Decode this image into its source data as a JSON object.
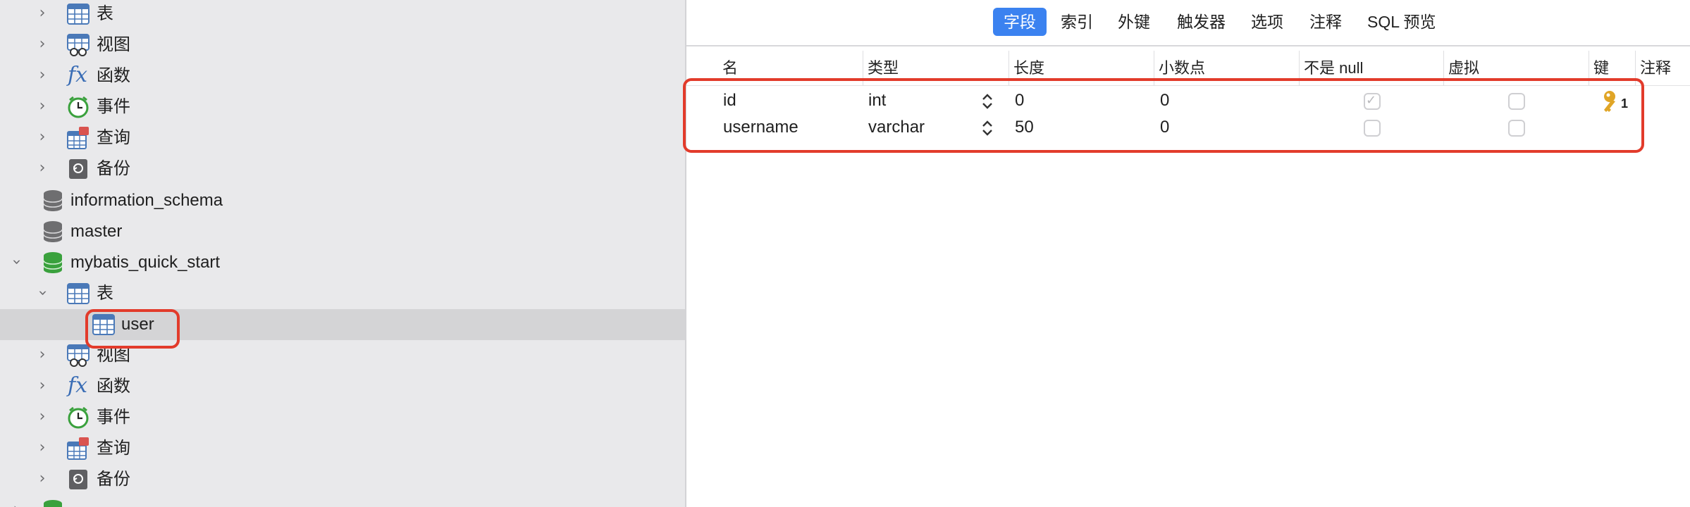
{
  "sidebar": {
    "items": [
      {
        "label": "表",
        "icon": "table-icon",
        "expand": "collapsed",
        "level": 1
      },
      {
        "label": "视图",
        "icon": "view-icon",
        "expand": "collapsed",
        "level": 1
      },
      {
        "label": "函数",
        "icon": "function-icon",
        "expand": "collapsed",
        "level": 1
      },
      {
        "label": "事件",
        "icon": "event-clock-icon",
        "expand": "collapsed",
        "level": 1
      },
      {
        "label": "查询",
        "icon": "query-icon",
        "expand": "collapsed",
        "level": 1
      },
      {
        "label": "备份",
        "icon": "backup-icon",
        "expand": "collapsed",
        "level": 1
      },
      {
        "label": "information_schema",
        "icon": "database-gray-icon",
        "expand": "none",
        "level": 0
      },
      {
        "label": "master",
        "icon": "database-gray-icon",
        "expand": "none",
        "level": 0
      },
      {
        "label": "mybatis_quick_start",
        "icon": "database-green-icon",
        "expand": "expanded",
        "level": 0
      },
      {
        "label": "表",
        "icon": "table-icon",
        "expand": "expanded",
        "level": 1
      },
      {
        "label": "user",
        "icon": "table-icon",
        "expand": "none",
        "level": 2,
        "selected": true
      },
      {
        "label": "视图",
        "icon": "view-icon",
        "expand": "collapsed",
        "level": 1
      },
      {
        "label": "函数",
        "icon": "function-icon",
        "expand": "collapsed",
        "level": 1
      },
      {
        "label": "事件",
        "icon": "event-clock-icon",
        "expand": "collapsed",
        "level": 1
      },
      {
        "label": "查询",
        "icon": "query-icon",
        "expand": "collapsed",
        "level": 1
      },
      {
        "label": "备份",
        "icon": "backup-icon",
        "expand": "collapsed",
        "level": 1
      },
      {
        "label": "",
        "icon": "database-green-icon",
        "expand": "collapsed",
        "level": 0
      }
    ]
  },
  "tabs": [
    {
      "label": "字段",
      "active": true
    },
    {
      "label": "索引"
    },
    {
      "label": "外键"
    },
    {
      "label": "触发器"
    },
    {
      "label": "选项"
    },
    {
      "label": "注释"
    },
    {
      "label": "SQL 预览"
    }
  ],
  "columns": [
    "名",
    "类型",
    "长度",
    "小数点",
    "不是 null",
    "虚拟",
    "键",
    "注释"
  ],
  "rows": [
    {
      "name": "id",
      "type": "int",
      "length": "0",
      "decimals": "0",
      "not_null": true,
      "virtual": false,
      "key": "1"
    },
    {
      "name": "username",
      "type": "varchar",
      "length": "50",
      "decimals": "0",
      "not_null": false,
      "virtual": false,
      "key": ""
    }
  ],
  "colors": {
    "sidebar_bg": "#e9e9eb",
    "selected_row": "#d4d4d6",
    "active_tab": "#3b82f0",
    "highlight": "#e23b2b",
    "db_green": "#3aa13d",
    "key_gold": "#e0a526"
  }
}
